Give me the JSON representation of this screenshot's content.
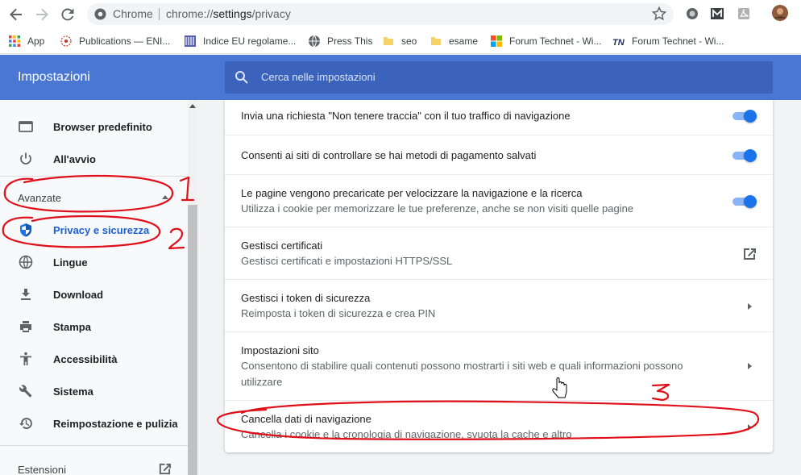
{
  "browser": {
    "omnibox_scheme_label": "Chrome",
    "url_prefix": "chrome://",
    "url_path": "settings",
    "url_suffix": "/privacy"
  },
  "bookmarks": [
    {
      "label": "App"
    },
    {
      "label": "Publications — ENI..."
    },
    {
      "label": "Indice EU regolame..."
    },
    {
      "label": "Press This"
    },
    {
      "label": "seo"
    },
    {
      "label": "esame"
    },
    {
      "label": "Forum Technet - Wi..."
    },
    {
      "label": "Forum Technet - Wi..."
    }
  ],
  "header": {
    "title": "Impostazioni",
    "search_placeholder": "Cerca nelle impostazioni"
  },
  "sidebar": {
    "items_top": [
      {
        "label": "Browser predefinito",
        "icon": "browser-icon"
      },
      {
        "label": "All'avvio",
        "icon": "power-icon"
      }
    ],
    "advanced_label": "Avanzate",
    "items_advanced": [
      {
        "label": "Privacy e sicurezza",
        "icon": "shield-icon",
        "active": true
      },
      {
        "label": "Lingue",
        "icon": "globe-icon"
      },
      {
        "label": "Download",
        "icon": "download-icon"
      },
      {
        "label": "Stampa",
        "icon": "printer-icon"
      },
      {
        "label": "Accessibilità",
        "icon": "accessibility-icon"
      },
      {
        "label": "Sistema",
        "icon": "wrench-icon"
      },
      {
        "label": "Reimpostazione e pulizia",
        "icon": "restore-icon"
      }
    ],
    "extensions_label": "Estensioni"
  },
  "settings": [
    {
      "title": "Invia una richiesta \"Non tenere traccia\" con il tuo traffico di navigazione",
      "control": "toggle",
      "on": true
    },
    {
      "title": "Consenti ai siti di controllare se hai metodi di pagamento salvati",
      "control": "toggle",
      "on": true
    },
    {
      "title": "Le pagine vengono precaricate per velocizzare la navigazione e la ricerca",
      "subtitle": "Utilizza i cookie per memorizzare le tue preferenze, anche se non visiti quelle pagine",
      "control": "toggle",
      "on": true
    },
    {
      "title": "Gestisci certificati",
      "subtitle": "Gestisci certificati e impostazioni HTTPS/SSL",
      "control": "external-link"
    },
    {
      "title": "Gestisci i token di sicurezza",
      "subtitle": "Reimposta i token di sicurezza e crea PIN",
      "control": "arrow"
    },
    {
      "title": "Impostazioni sito",
      "subtitle": "Consentono di stabilire quali contenuti possono mostrarti i siti web e quali informazioni possono utilizzare",
      "control": "arrow"
    },
    {
      "title": "Cancella dati di navigazione",
      "subtitle": "Cancella i cookie e la cronologia di navigazione, svuota la cache e altro",
      "control": "arrow"
    }
  ],
  "annotations": {
    "color": "#e0101a",
    "marks": [
      "1",
      "2",
      "3"
    ]
  },
  "colors": {
    "accent": "#1a73e8",
    "header": "#4a77d4",
    "toggle_track": "#8ab4f8"
  }
}
